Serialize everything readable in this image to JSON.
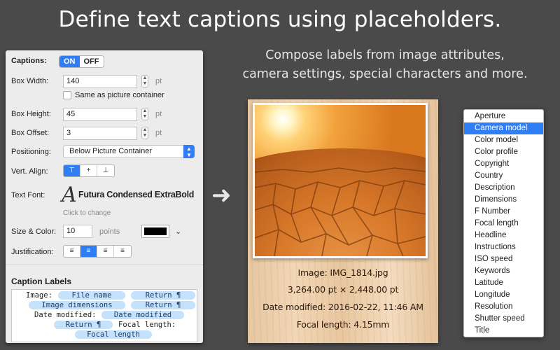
{
  "headline": "Define text captions using placeholders.",
  "subline": [
    "Compose labels from image attributes,",
    "camera settings, special characters and more."
  ],
  "panel": {
    "captions_label": "Captions:",
    "toggle_on": "ON",
    "toggle_off": "OFF",
    "box_width_label": "Box Width:",
    "box_width_value": "140",
    "unit_pt": "pt",
    "same_as_container": "Same as picture container",
    "box_height_label": "Box Height:",
    "box_height_value": "45",
    "box_offset_label": "Box Offset:",
    "box_offset_value": "3",
    "positioning_label": "Positioning:",
    "positioning_value": "Below Picture Container",
    "vert_align_label": "Vert. Align:",
    "text_font_label": "Text Font:",
    "font_name": "Futura Condensed ExtraBold",
    "font_glyph": "A",
    "click_to_change": "Click to change",
    "size_color_label": "Size & Color:",
    "size_value": "10",
    "points_label": "points",
    "color_swatch": "#000000",
    "justification_label": "Justification:",
    "caption_labels_title": "Caption Labels",
    "caption_lines": {
      "l1_text": "Image:",
      "l1_token1": "File name",
      "l1_token2": "Return ¶",
      "l2_token1": "Image dimensions",
      "l2_token2": "Return ¶",
      "l3_text": "Date modified:",
      "l3_token1": "Date modified",
      "l4_token1": "Return ¶",
      "l4_text": "Focal length:",
      "l5_token1": "Focal length"
    }
  },
  "picture": {
    "caption_lines": [
      "Image: IMG_1814.jpg",
      "3,264.00 pt × 2,448.00 pt",
      "Date modified: 2016-02-22, 11:46 AM",
      "Focal length: 4.15mm"
    ]
  },
  "placeholder_list": {
    "selected": "Camera model",
    "items": [
      "Aperture",
      "Camera model",
      "Color model",
      "Color profile",
      "Copyright",
      "Country",
      "Description",
      "Dimensions",
      "F Number",
      "Focal length",
      "Headline",
      "Instructions",
      "ISO speed",
      "Keywords",
      "Latitude",
      "Longitude",
      "Resolution",
      "Shutter speed",
      "Title"
    ]
  },
  "icons": {
    "arrow": "right-arrow-icon",
    "stepper": "stepper-icon",
    "select_arrow": "updown-chevron-icon",
    "chevron": "chevron-down-icon"
  },
  "colors": {
    "accent": "#2f7ef6",
    "background": "#4a4a4a",
    "token": "#c4e2fb"
  }
}
